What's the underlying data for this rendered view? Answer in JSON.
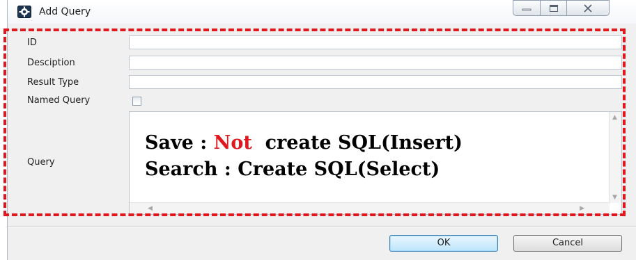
{
  "window": {
    "title": "Add Query",
    "app_icon": "app-gear-icon",
    "controls": [
      "minimize-icon",
      "maximize-icon",
      "close-icon"
    ]
  },
  "form": {
    "id_label": "ID",
    "id_value": "",
    "description_label": "Desciption",
    "description_value": "",
    "result_type_label": "Result Type",
    "result_type_value": "",
    "named_query_label": "Named Query",
    "named_query_checked": false,
    "query_label": "Query",
    "query_value": ""
  },
  "annotation": {
    "line1_prefix": "Save : ",
    "line1_highlight": "Not",
    "line1_suffix": "  create SQL(Insert)",
    "line2": "Search : Create SQL(Select)",
    "highlight_color": "#e0171e",
    "frame_color": "#e0171e"
  },
  "buttons": {
    "ok_label": "OK",
    "cancel_label": "Cancel"
  }
}
